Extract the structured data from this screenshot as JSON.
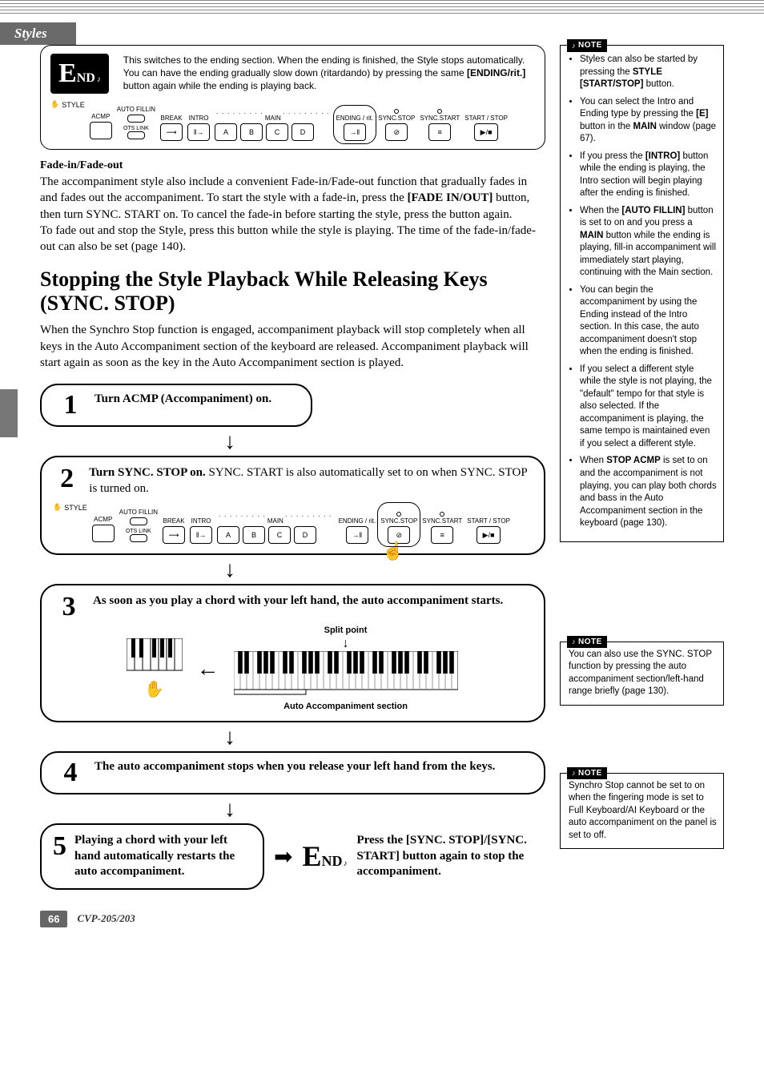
{
  "header": {
    "tab": "Styles"
  },
  "end_box": {
    "badge_big": "E",
    "badge_small": "ND",
    "text_pre": "This switches to the ending section. When the ending is finished, the Style stops automatically. You can have the ending gradually slow down (ritardando) by pressing the same ",
    "text_bold": "[ENDING/rit.]",
    "text_post": " button again while the ending is playing back."
  },
  "style_panel": {
    "style_label": "STYLE",
    "acmp": "ACMP",
    "auto_fillin": "AUTO FILLIN",
    "ots_link": "OTS LINK",
    "break": "BREAK",
    "intro": "INTRO",
    "main": "MAIN",
    "ending": "ENDING / rit.",
    "sync_stop": "SYNC.STOP",
    "sync_start": "SYNC.START",
    "start_stop": "START / STOP",
    "main_a": "A",
    "main_b": "B",
    "main_c": "C",
    "main_d": "D"
  },
  "fade": {
    "heading": "Fade-in/Fade-out",
    "p1a": "The accompaniment style also include a convenient Fade-in/Fade-out function that gradually fades in and fades out the accompaniment. To start the style with a fade-in, press the ",
    "p1b": "[FADE IN/OUT]",
    "p1c": " button, then turn SYNC. START on. To cancel the fade-in before starting the style, press the button again.",
    "p2": "To fade out and stop the Style, press this button while the style is playing. The time of the fade-in/fade-out can also be set (page 140)."
  },
  "section_title": "Stopping the Style Playback While Releasing Keys (SYNC. STOP)",
  "intro_para": "When the Synchro Stop function is engaged, accompaniment playback will stop completely when all keys in the Auto Accompaniment section of the keyboard are released. Accompaniment playback will start again as soon as the key in the Auto Accompaniment section is played.",
  "steps": {
    "s1_num": "1",
    "s1_text": "Turn ACMP (Accompaniment) on.",
    "s2_num": "2",
    "s2_bold": "Turn SYNC. STOP on.",
    "s2_rest": " SYNC. START is also automatically set to on when SYNC. STOP is turned on.",
    "s3_num": "3",
    "s3_text": "As soon as you play a chord with your left hand, the auto accompaniment starts.",
    "s3_split": "Split point",
    "s3_autoacc": "Auto Accompaniment section",
    "s4_num": "4",
    "s4_text": "The auto accompaniment stops when you release your left hand from the keys.",
    "s5_num": "5",
    "s5_text": "Playing a chord with your left hand automatically restarts the auto accompaniment.",
    "s5_end_text": "Press the [SYNC. STOP]/[SYNC. START] button again to stop the accompaniment."
  },
  "notes": {
    "n1_label": "NOTE",
    "n1_items": [
      {
        "pre": "Styles can also be started by pressing the ",
        "b": "STYLE [START/STOP]",
        "post": " button."
      },
      {
        "pre": "You can select the Intro and Ending type by pressing the ",
        "b": "[E]",
        "post": " button in the ",
        "b2": "MAIN",
        "post2": " window (page 67)."
      },
      {
        "pre": "If you press the ",
        "b": "[INTRO]",
        "post": " button while the ending is playing, the Intro section will begin playing after the ending is finished."
      },
      {
        "pre": "When the ",
        "b": "[AUTO FILLIN]",
        "post": " button is set to on and you press a ",
        "b2": "MAIN",
        "post2": " button while the ending is playing, fill-in accompaniment will immediately start playing, continuing with the Main section."
      },
      {
        "pre": "You can begin the accompaniment by using the Ending instead of the Intro section. In this case, the auto accompaniment doesn't stop when the ending is finished.",
        "b": "",
        "post": ""
      },
      {
        "pre": "If you select a different style while the style is not playing, the \"default\" tempo for that style is also selected. If the accompaniment is playing, the same tempo is maintained even if you select a different style.",
        "b": "",
        "post": ""
      },
      {
        "pre": "When ",
        "b": "STOP ACMP",
        "post": " is set to on and the accompaniment is not playing, you can play both chords and bass in the Auto Accompaniment section in the keyboard (page 130)."
      }
    ],
    "n2_label": "NOTE",
    "n2_text": "You can also use the SYNC. STOP function by pressing the auto accompaniment section/left-hand range briefly (page 130).",
    "n3_label": "NOTE",
    "n3_text": "Synchro Stop cannot be set to on when the fingering mode is set to Full Keyboard/AI Keyboard or the auto accompaniment on the panel is set to off."
  },
  "footer": {
    "page_num": "66",
    "model": "CVP-205/203"
  }
}
